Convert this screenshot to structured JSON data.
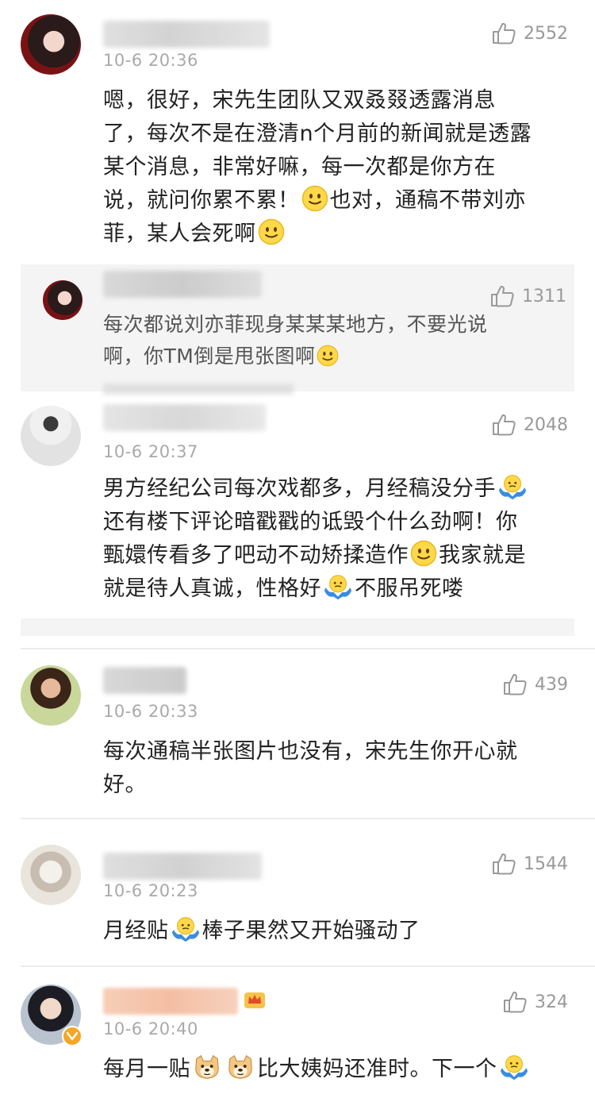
{
  "comments": [
    {
      "timestamp": "10-6 20:36",
      "likes": "2552",
      "text_lines": [
        "嗯，很好，宋先生团队又双叒叕透露消息",
        "了，每次不是在澄清n个月前的新闻就是透露",
        "某个消息，非常好嘛，每一次都是你方在",
        "说，就问你累不累！",
        "也对，通稿不带刘亦",
        "菲，某人会死啊"
      ],
      "reply": {
        "likes": "1311",
        "text_lines": [
          "每次都说刘亦菲现身某某某地方，不要光说",
          "啊，你TM倒是甩张图啊"
        ]
      }
    },
    {
      "timestamp": "10-6 20:37",
      "likes": "2048",
      "text_lines": [
        "男方经纪公司每次戏都多，月经稿没分手",
        "还有楼下评论暗戳戳的诋毁个什么劲啊！你",
        "甄嬛传看多了吧动不动矫揉造作",
        "我家就是",
        "就是待人真诚，性格好",
        "不服吊死喽"
      ]
    },
    {
      "timestamp": "10-6 20:33",
      "likes": "439",
      "text_lines": [
        "每次通稿半张图片也没有，宋先生你开心就",
        "好。"
      ]
    },
    {
      "timestamp": "10-6 20:23",
      "likes": "1544",
      "text_lines": [
        "月经贴",
        "棒子果然又开始骚动了"
      ]
    },
    {
      "timestamp": "10-6 20:40",
      "likes": "324",
      "text_lines": [
        "每月一贴",
        "比大姨妈还准时。下一个"
      ]
    }
  ],
  "icons": {
    "like": "thumbs-up-icon",
    "smile": "smile-emoji-icon",
    "shrug": "shrug-emoji-icon",
    "doge": "doge-emoji-icon",
    "verified": "verified-badge-icon",
    "crown": "crown-icon"
  },
  "colors": {
    "timestamp": "#a9a9a9",
    "reply_bg": "#f4f4f4",
    "verified": "#f5a623"
  }
}
